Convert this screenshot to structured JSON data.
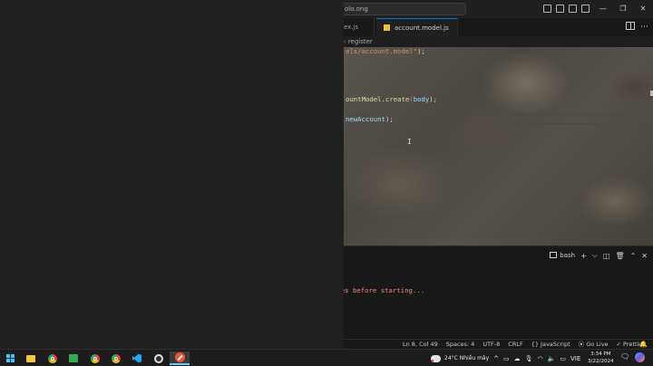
{
  "window": {
    "search_text": "olo.ong",
    "minimize": "—",
    "restore": "❐",
    "close": "✕"
  },
  "tabs": [
    {
      "label": "ex.js"
    },
    {
      "label": "account.model.js"
    }
  ],
  "breadcrumb": {
    "item": "register"
  },
  "code": {
    "line1_str": "els/account.model\"",
    "line1_end": ");",
    "line2_fn": "ountModel.create",
    "line2_paren_open": "(",
    "line2_var": "body",
    "line2_end": ");",
    "line3_var": "newAccount",
    "line3_end": ");"
  },
  "terminal": {
    "shell_label": "bash",
    "add": "+",
    "dropdown": "⌵",
    "split": "◫",
    "trash": "🗑",
    "maximize": "⌃",
    "close": "✕",
    "output": "nges before starting..."
  },
  "statusbar": {
    "position": "Ln 8, Col 49",
    "spaces": "Spaces: 4",
    "encoding": "UTF-8",
    "eol": "CRLF",
    "language": "{} JavaScript",
    "golive": "⦿ Go Live",
    "prettier": "✓ Prettier",
    "bell": "🔔"
  },
  "taskbar": {
    "weather": "24°C  Nhiều mây",
    "lang": "VIE",
    "time": "3:34 PM",
    "date": "3/22/2024",
    "tray_chevron": "^",
    "notif": "🗨"
  },
  "colors": {
    "accent": "#0078d4",
    "js_badge": "#e8c138",
    "terminal_warning": "#f48771",
    "string": "#ce9178",
    "function": "#dcdcaa"
  }
}
